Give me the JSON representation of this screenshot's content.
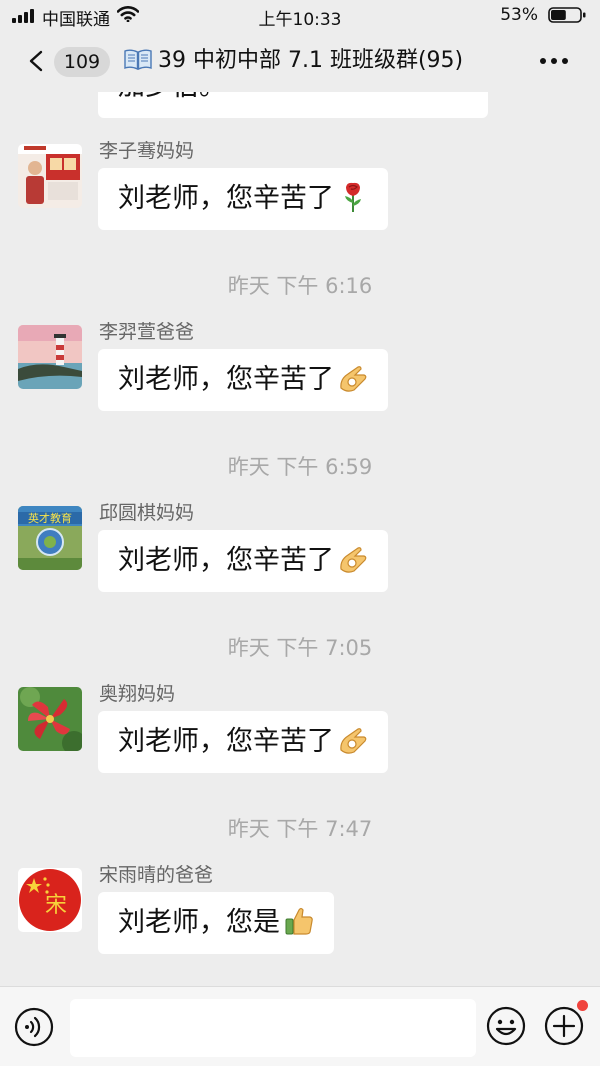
{
  "status_bar": {
    "carrier": "中国联通",
    "time": "上午10:33",
    "battery": "53%",
    "battery_level": 0.53
  },
  "nav": {
    "unread_count": "109",
    "title": "39 中初中部 7.1 班班级群(95)",
    "title_icon": "open-book-icon",
    "more_icon": "more-dots-icon"
  },
  "chat": {
    "partial_message": "加步伯。",
    "messages": [
      {
        "sender": "李子骞妈妈",
        "text": "刘老师，您辛苦了",
        "emoji": "rose-icon",
        "avatar": "promo-photo-avatar"
      },
      {
        "timestamp": "昨天 下午 6:16",
        "sender": "李羿萱爸爸",
        "text": "刘老师，您辛苦了",
        "emoji": "ok-hand-icon",
        "avatar": "lighthouse-avatar"
      },
      {
        "timestamp": "昨天 下午 6:59",
        "sender": "邱圆棋妈妈",
        "text": "刘老师，您辛苦了",
        "emoji": "ok-hand-icon",
        "avatar": "education-logo-avatar"
      },
      {
        "timestamp": "昨天 下午 7:05",
        "sender": "奥翔妈妈",
        "text": "刘老师，您辛苦了",
        "emoji": "ok-hand-icon",
        "avatar": "red-flower-avatar"
      },
      {
        "timestamp": "昨天 下午 7:47",
        "sender": "宋雨晴的爸爸",
        "text": "刘老师，您是",
        "emoji": "thumbs-up-icon",
        "avatar": "song-flag-avatar"
      }
    ]
  },
  "input_bar": {
    "value": "",
    "icons": [
      "voice-icon",
      "emoji-smiley-icon",
      "plus-icon"
    ]
  },
  "colors": {
    "background": "#ededed",
    "bubble": "#ffffff",
    "badge_dot": "#f0433d"
  }
}
